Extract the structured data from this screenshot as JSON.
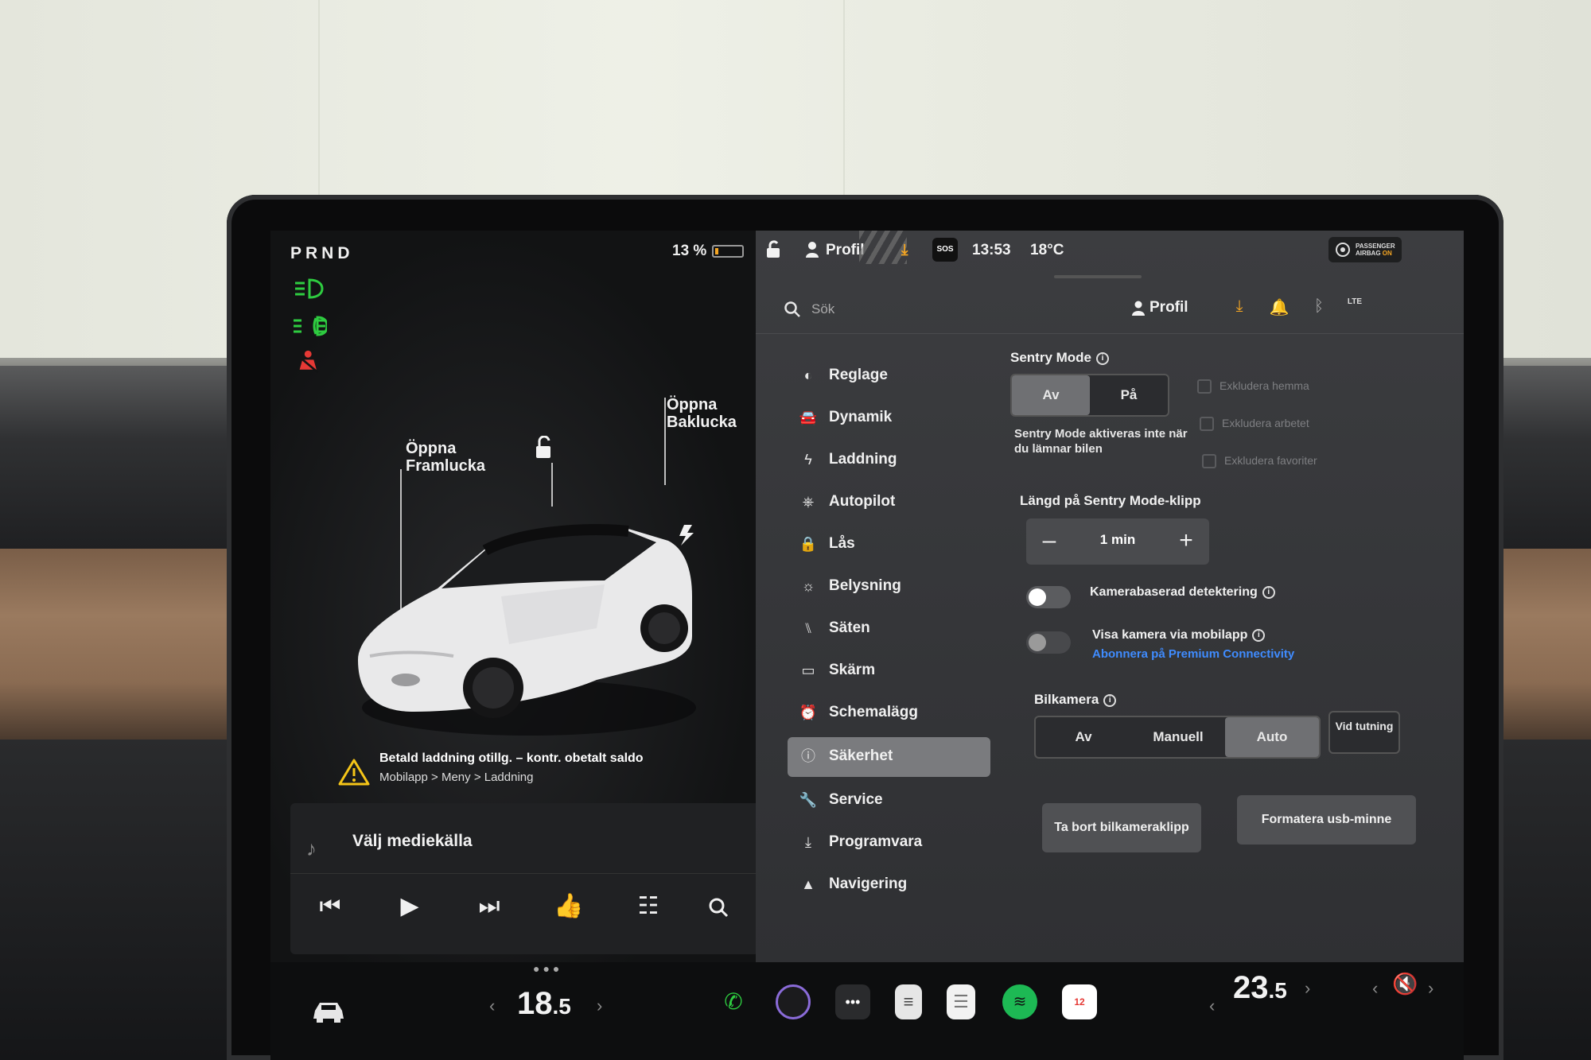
{
  "left_panel": {
    "gear": "PRND",
    "battery_percent": "13 %",
    "battery_level": 0.13,
    "indicators": [
      "headlight-icon",
      "fog-light-icon",
      "seatbelt-warning-icon"
    ],
    "frunk_label": "Öppna Framlucka",
    "trunk_label": "Öppna Baklucka",
    "alert": {
      "title": "Betald laddning otillg. – kontr. obetalt saldo",
      "subtitle": "Mobilapp > Meny > Laddning"
    },
    "media": {
      "title": "Välj mediekälla"
    }
  },
  "status_bar": {
    "profile": "Profil",
    "sos": "SOS",
    "time": "13:53",
    "outside_temp": "18°C",
    "airbag_line1": "PASSENGER",
    "airbag_line2": "AIRBAG",
    "airbag_on": "ON"
  },
  "header": {
    "search_placeholder": "Sök",
    "profile": "Profil",
    "lte": "LTE"
  },
  "menu": {
    "items": [
      {
        "label": "Reglage",
        "icon": "toggle-icon"
      },
      {
        "label": "Dynamik",
        "icon": "car-icon"
      },
      {
        "label": "Laddning",
        "icon": "bolt-icon"
      },
      {
        "label": "Autopilot",
        "icon": "steering-wheel-icon"
      },
      {
        "label": "Lås",
        "icon": "lock-icon"
      },
      {
        "label": "Belysning",
        "icon": "sun-icon"
      },
      {
        "label": "Säten",
        "icon": "seat-icon"
      },
      {
        "label": "Skärm",
        "icon": "display-icon"
      },
      {
        "label": "Schemalägg",
        "icon": "alarm-icon"
      },
      {
        "label": "Säkerhet",
        "icon": "info-circle-icon",
        "active": true
      },
      {
        "label": "Service",
        "icon": "wrench-icon"
      },
      {
        "label": "Programvara",
        "icon": "download-icon"
      },
      {
        "label": "Navigering",
        "icon": "navigation-icon"
      }
    ]
  },
  "safety": {
    "sentry_title": "Sentry Mode",
    "sentry_options": [
      "Av",
      "På"
    ],
    "sentry_selected": "Av",
    "sentry_note": "Sentry Mode aktiveras inte när du lämnar bilen",
    "exclusions": [
      "Exkludera hemma",
      "Exkludera arbetet",
      "Exkludera favoriter"
    ],
    "clip_length_title": "Längd på Sentry Mode-klipp",
    "clip_length_value": "1 min",
    "camera_detection_label": "Kamerabaserad detektering",
    "camera_detection_on": false,
    "mobile_camera_label": "Visa kamera via mobilapp",
    "mobile_camera_on": false,
    "premium_link": "Abonnera på Premium Connectivity",
    "dashcam_title": "Bilkamera",
    "dashcam_options": [
      "Av",
      "Manuell",
      "Auto",
      "Vid tutning"
    ],
    "dashcam_selected": "Auto",
    "delete_clips_button": "Ta bort bilkameraklipp",
    "format_usb_button": "Formatera usb-minne"
  },
  "dock": {
    "driver_temp": "18",
    "driver_temp_decimal": ".5",
    "passenger_temp": "23",
    "passenger_temp_decimal": ".5",
    "calendar_day": "12"
  },
  "colors": {
    "accent_link": "#3f8cff",
    "indicator_green": "#2ecc40",
    "warning_red": "#e53935",
    "warning_yellow": "#f5c518"
  }
}
